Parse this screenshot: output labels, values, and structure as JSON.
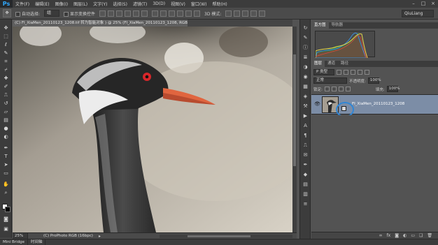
{
  "app": {
    "logo": "Ps",
    "menu": [
      "文件(F)",
      "编辑(E)",
      "图像(I)",
      "图层(L)",
      "文字(Y)",
      "选择(S)",
      "滤镜(T)",
      "3D(D)",
      "视图(V)",
      "窗口(W)",
      "帮助(H)"
    ],
    "window_controls": [
      "–",
      "□",
      "×"
    ]
  },
  "options_bar": {
    "auto_select_label": "自动选择:",
    "auto_select_value": "组",
    "show_transform_label": "显示变换控件",
    "mode_3d_label": "3D 模式:",
    "workspace": "QiuLiang"
  },
  "document": {
    "tab_title": "(C) FI_XiaMen_20110123_1208.tif 转为智能对象 ) @ 25% (FI_XiaMen_20110123_1208, RGB/16) *",
    "zoom": "25%",
    "doc_info": "(C) ProPhoto RGB (16bpc)"
  },
  "bottom_tabs": [
    "Mini Bridge",
    "时间轴"
  ],
  "panels": {
    "top_tabs": [
      "直方图",
      "导航器"
    ],
    "layers_tabs": [
      "图层",
      "通道",
      "路径"
    ],
    "kind_label": "P 类型",
    "blend_mode": "正常",
    "opacity_label": "不透明度:",
    "opacity_value": "100%",
    "lock_label": "锁定:",
    "fill_label": "填充:",
    "fill_value": "100%",
    "layer_name": "FI_XiaMen_20110123_1208"
  },
  "colors": {
    "accent": "#31a8ff",
    "selection": "#7c8da6",
    "highlight_circle": "#2f86d6",
    "eye_red": "#d8262a",
    "beak": "#e0653f"
  }
}
